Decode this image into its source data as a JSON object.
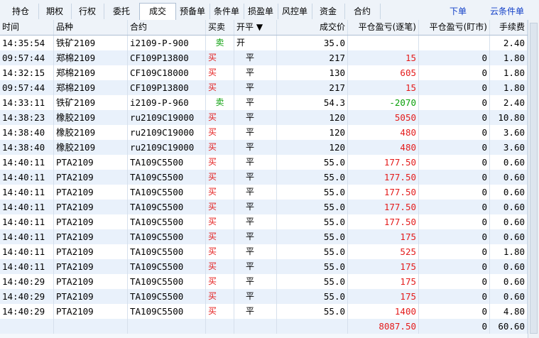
{
  "tabs": [
    {
      "label": "持仓",
      "active": false
    },
    {
      "label": "期权",
      "active": false
    },
    {
      "label": "行权",
      "active": false
    },
    {
      "label": "委托",
      "active": false
    },
    {
      "label": "成交",
      "active": true
    },
    {
      "label": "预备单",
      "active": false
    },
    {
      "label": "条件单",
      "active": false
    },
    {
      "label": "损盈单",
      "active": false
    },
    {
      "label": "风控单",
      "active": false
    },
    {
      "label": "资金",
      "active": false
    },
    {
      "label": "合约",
      "active": false
    }
  ],
  "links": {
    "place_order": "下单",
    "cloud_conditional": "云条件单"
  },
  "headers": {
    "time": "时间",
    "product": "品种",
    "contract": "合约",
    "side": "买卖",
    "open_close": "开平 ▼",
    "price": "成交价",
    "pnl_close": "平仓盈亏(逐笔)",
    "pnl_mtm": "平仓盈亏(盯市)",
    "fee": "手续费"
  },
  "rows": [
    {
      "time": "14:35:54",
      "product": "铁矿2109",
      "contract": "i2109-P-900",
      "side": "卖",
      "oc": "开",
      "price": "35.0",
      "pnl": "",
      "mtm": "",
      "fee": "2.40"
    },
    {
      "time": "09:57:44",
      "product": "郑棉2109",
      "contract": "CF109P13800",
      "side": "买",
      "oc": "平",
      "price": "217",
      "pnl": "15",
      "mtm": "0",
      "fee": "1.80"
    },
    {
      "time": "14:32:15",
      "product": "郑棉2109",
      "contract": "CF109C18000",
      "side": "买",
      "oc": "平",
      "price": "130",
      "pnl": "605",
      "mtm": "0",
      "fee": "1.80"
    },
    {
      "time": "09:57:44",
      "product": "郑棉2109",
      "contract": "CF109P13800",
      "side": "买",
      "oc": "平",
      "price": "217",
      "pnl": "15",
      "mtm": "0",
      "fee": "1.80"
    },
    {
      "time": "14:33:11",
      "product": "铁矿2109",
      "contract": "i2109-P-960",
      "side": "卖",
      "oc": "平",
      "price": "54.3",
      "pnl": "-2070",
      "mtm": "0",
      "fee": "2.40"
    },
    {
      "time": "14:38:23",
      "product": "橡胶2109",
      "contract": "ru2109C19000",
      "side": "买",
      "oc": "平",
      "price": "120",
      "pnl": "5050",
      "mtm": "0",
      "fee": "10.80"
    },
    {
      "time": "14:38:40",
      "product": "橡胶2109",
      "contract": "ru2109C19000",
      "side": "买",
      "oc": "平",
      "price": "120",
      "pnl": "480",
      "mtm": "0",
      "fee": "3.60"
    },
    {
      "time": "14:38:40",
      "product": "橡胶2109",
      "contract": "ru2109C19000",
      "side": "买",
      "oc": "平",
      "price": "120",
      "pnl": "480",
      "mtm": "0",
      "fee": "3.60"
    },
    {
      "time": "14:40:11",
      "product": "PTA2109",
      "contract": "TA109C5500",
      "side": "买",
      "oc": "平",
      "price": "55.0",
      "pnl": "177.50",
      "mtm": "0",
      "fee": "0.60"
    },
    {
      "time": "14:40:11",
      "product": "PTA2109",
      "contract": "TA109C5500",
      "side": "买",
      "oc": "平",
      "price": "55.0",
      "pnl": "177.50",
      "mtm": "0",
      "fee": "0.60"
    },
    {
      "time": "14:40:11",
      "product": "PTA2109",
      "contract": "TA109C5500",
      "side": "买",
      "oc": "平",
      "price": "55.0",
      "pnl": "177.50",
      "mtm": "0",
      "fee": "0.60"
    },
    {
      "time": "14:40:11",
      "product": "PTA2109",
      "contract": "TA109C5500",
      "side": "买",
      "oc": "平",
      "price": "55.0",
      "pnl": "177.50",
      "mtm": "0",
      "fee": "0.60"
    },
    {
      "time": "14:40:11",
      "product": "PTA2109",
      "contract": "TA109C5500",
      "side": "买",
      "oc": "平",
      "price": "55.0",
      "pnl": "177.50",
      "mtm": "0",
      "fee": "0.60"
    },
    {
      "time": "14:40:11",
      "product": "PTA2109",
      "contract": "TA109C5500",
      "side": "买",
      "oc": "平",
      "price": "55.0",
      "pnl": "175",
      "mtm": "0",
      "fee": "0.60"
    },
    {
      "time": "14:40:11",
      "product": "PTA2109",
      "contract": "TA109C5500",
      "side": "买",
      "oc": "平",
      "price": "55.0",
      "pnl": "525",
      "mtm": "0",
      "fee": "1.80"
    },
    {
      "time": "14:40:11",
      "product": "PTA2109",
      "contract": "TA109C5500",
      "side": "买",
      "oc": "平",
      "price": "55.0",
      "pnl": "175",
      "mtm": "0",
      "fee": "0.60"
    },
    {
      "time": "14:40:29",
      "product": "PTA2109",
      "contract": "TA109C5500",
      "side": "买",
      "oc": "平",
      "price": "55.0",
      "pnl": "175",
      "mtm": "0",
      "fee": "0.60"
    },
    {
      "time": "14:40:29",
      "product": "PTA2109",
      "contract": "TA109C5500",
      "side": "买",
      "oc": "平",
      "price": "55.0",
      "pnl": "175",
      "mtm": "0",
      "fee": "0.60"
    },
    {
      "time": "14:40:29",
      "product": "PTA2109",
      "contract": "TA109C5500",
      "side": "买",
      "oc": "平",
      "price": "55.0",
      "pnl": "1400",
      "mtm": "0",
      "fee": "4.80"
    }
  ],
  "totals": {
    "pnl": "8087.50",
    "mtm": "0",
    "fee": "60.60"
  },
  "colors": {
    "buy": "#e41b1b",
    "sell": "#0aa00a",
    "profit": "#e41b1b",
    "loss": "#0aa00a",
    "link": "#1340c8"
  }
}
